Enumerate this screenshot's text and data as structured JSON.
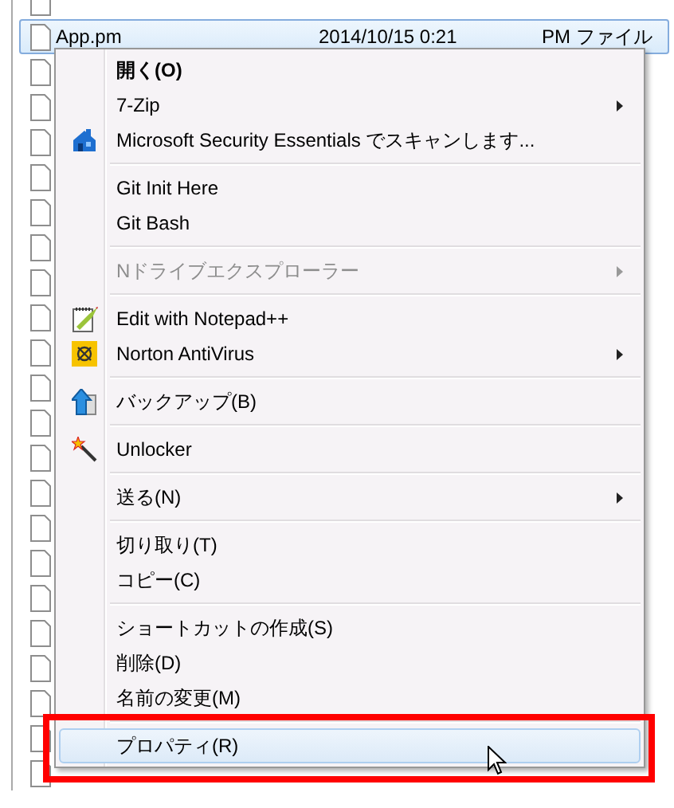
{
  "file_list": {
    "rows": [
      {
        "name": "App.pm",
        "date": "2014/10/15 0:21",
        "type": "PM ファイル",
        "selected": true
      }
    ]
  },
  "context_menu": {
    "items": [
      {
        "kind": "item",
        "label": "開く(O)",
        "default": true,
        "submenu": false,
        "disabled": false,
        "selected": false
      },
      {
        "kind": "item",
        "label": "7-Zip",
        "default": false,
        "submenu": true,
        "disabled": false,
        "selected": false
      },
      {
        "kind": "item",
        "label": "Microsoft Security Essentials でスキャンします...",
        "default": false,
        "submenu": false,
        "disabled": false,
        "selected": false
      },
      {
        "kind": "separator"
      },
      {
        "kind": "item",
        "label": "Git Init Here",
        "default": false,
        "submenu": false,
        "disabled": false,
        "selected": false
      },
      {
        "kind": "item",
        "label": "Git Bash",
        "default": false,
        "submenu": false,
        "disabled": false,
        "selected": false
      },
      {
        "kind": "separator"
      },
      {
        "kind": "item",
        "label": "Nドライブエクスプローラー",
        "default": false,
        "submenu": true,
        "disabled": true,
        "selected": false
      },
      {
        "kind": "separator"
      },
      {
        "kind": "item",
        "label": "Edit with Notepad++",
        "default": false,
        "submenu": false,
        "disabled": false,
        "selected": false
      },
      {
        "kind": "item",
        "label": "Norton AntiVirus",
        "default": false,
        "submenu": true,
        "disabled": false,
        "selected": false
      },
      {
        "kind": "separator"
      },
      {
        "kind": "item",
        "label": "バックアップ(B)",
        "default": false,
        "submenu": false,
        "disabled": false,
        "selected": false
      },
      {
        "kind": "separator"
      },
      {
        "kind": "item",
        "label": "Unlocker",
        "default": false,
        "submenu": false,
        "disabled": false,
        "selected": false
      },
      {
        "kind": "separator"
      },
      {
        "kind": "item",
        "label": "送る(N)",
        "default": false,
        "submenu": true,
        "disabled": false,
        "selected": false
      },
      {
        "kind": "separator"
      },
      {
        "kind": "item",
        "label": "切り取り(T)",
        "default": false,
        "submenu": false,
        "disabled": false,
        "selected": false
      },
      {
        "kind": "item",
        "label": "コピー(C)",
        "default": false,
        "submenu": false,
        "disabled": false,
        "selected": false
      },
      {
        "kind": "separator"
      },
      {
        "kind": "item",
        "label": "ショートカットの作成(S)",
        "default": false,
        "submenu": false,
        "disabled": false,
        "selected": false
      },
      {
        "kind": "item",
        "label": "削除(D)",
        "default": false,
        "submenu": false,
        "disabled": false,
        "selected": false
      },
      {
        "kind": "item",
        "label": "名前の変更(M)",
        "default": false,
        "submenu": false,
        "disabled": false,
        "selected": false
      },
      {
        "kind": "separator"
      },
      {
        "kind": "item",
        "label": "プロパティ(R)",
        "default": false,
        "submenu": false,
        "disabled": false,
        "selected": true
      }
    ]
  },
  "highlight_frame": true
}
